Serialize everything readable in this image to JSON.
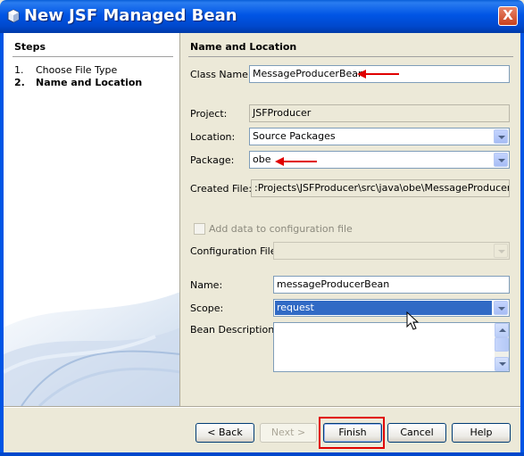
{
  "window": {
    "title": "New JSF Managed Bean",
    "close_glyph": "X"
  },
  "steps": {
    "heading": "Steps",
    "items": [
      {
        "num": "1.",
        "label": "Choose File Type",
        "active": false
      },
      {
        "num": "2.",
        "label": "Name and Location",
        "active": true
      }
    ]
  },
  "section": {
    "heading": "Name and Location"
  },
  "form": {
    "class_name": {
      "label": "Class Name:",
      "value": "MessageProducerBean"
    },
    "project": {
      "label": "Project:",
      "value": "JSFProducer"
    },
    "location": {
      "label": "Location:",
      "value": "Source Packages"
    },
    "package": {
      "label": "Package:",
      "value": "obe"
    },
    "created_file": {
      "label": "Created File:",
      "value": ":Projects\\JSFProducer\\src\\java\\obe\\MessageProducerBean"
    },
    "add_config": {
      "label": "Add data to configuration file",
      "checked": false,
      "enabled": false
    },
    "config_file": {
      "label": "Configuration File:",
      "value": ""
    },
    "name": {
      "label": "Name:",
      "value": "messageProducerBean"
    },
    "scope": {
      "label": "Scope:",
      "value": "request"
    },
    "description": {
      "label": "Bean Description:",
      "value": ""
    }
  },
  "buttons": {
    "back": "< Back",
    "next": "Next >",
    "finish": "Finish",
    "cancel": "Cancel",
    "help": "Help"
  },
  "colors": {
    "titlebar": "#0055e5",
    "annotation_red": "#e00000",
    "selection": "#316ac5"
  },
  "icons": [
    "bean-icon",
    "close-icon",
    "chevron-down-icon",
    "red-arrow-icon",
    "mouse-cursor-icon"
  ]
}
